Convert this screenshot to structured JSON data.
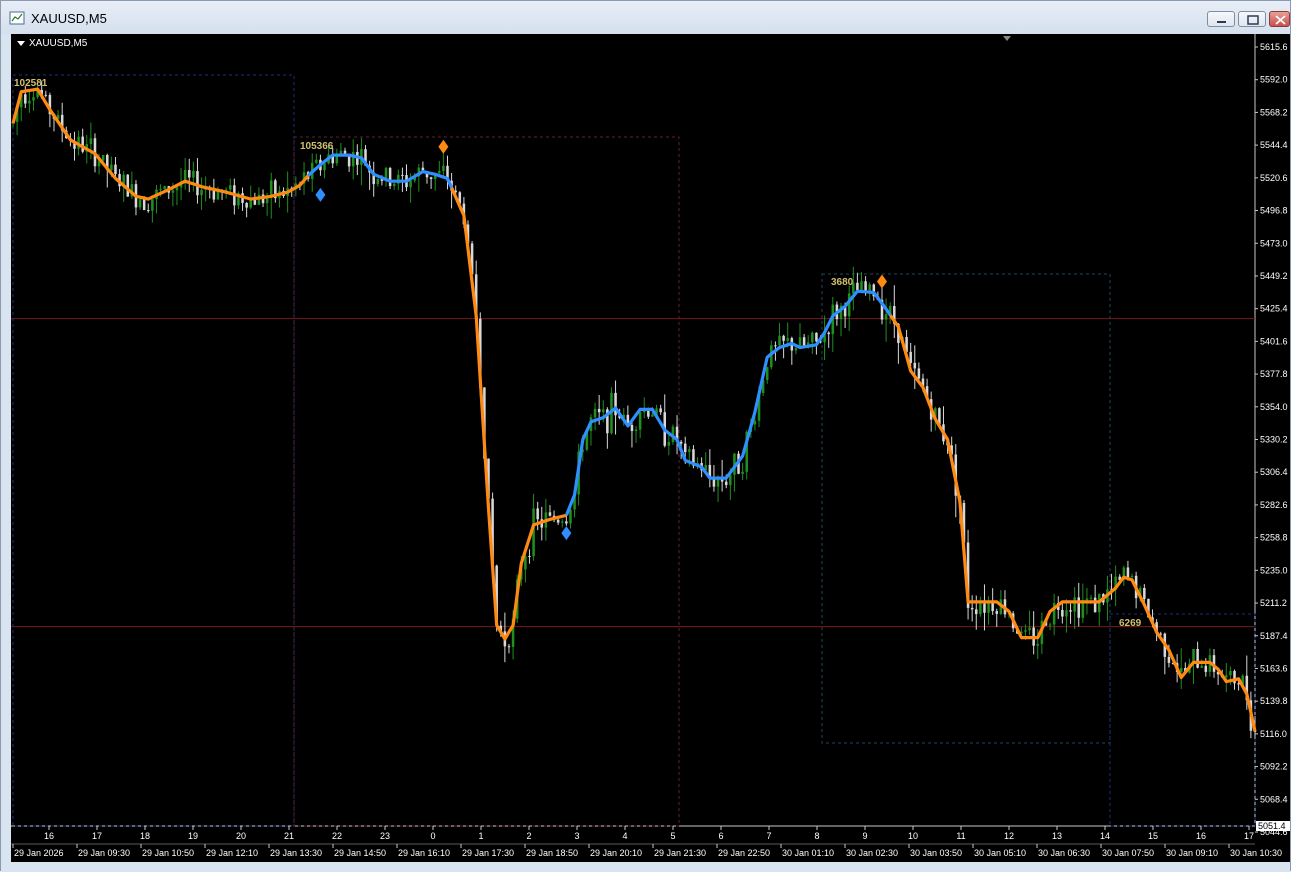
{
  "window": {
    "title": "XAUUSD,M5"
  },
  "chart": {
    "label": "XAUUSD,M5"
  },
  "colors": {
    "background": "#000000",
    "bull_candle": "#1f8f1f",
    "bear_candle": "#d8d8d8",
    "line_up": "#2f8fff",
    "line_down": "#ff8a12",
    "level_line": "#7a1a1a",
    "annotation_text": "#d0c070"
  },
  "price_axis": {
    "ticks": [
      "5615.6",
      "5592.0",
      "5568.2",
      "5544.4",
      "5520.6",
      "5496.8",
      "5473.0",
      "5449.2",
      "5425.4",
      "5401.6",
      "5377.8",
      "5354.0",
      "5330.2",
      "5306.4",
      "5282.6",
      "5258.8",
      "5235.0",
      "5211.2",
      "5187.4",
      "5163.6",
      "5139.8",
      "5116.0",
      "5092.2",
      "5068.4",
      "5044.6"
    ],
    "current_price": "5051.4"
  },
  "time_axis": {
    "hour_ticks": [
      "16",
      "17",
      "18",
      "19",
      "20",
      "21",
      "22",
      "23",
      "0",
      "1",
      "2",
      "3",
      "4",
      "5",
      "6",
      "7",
      "8",
      "9",
      "10",
      "11",
      "12",
      "13",
      "14",
      "15",
      "16",
      "17",
      "18"
    ],
    "date_labels": [
      "29 Jan 2026",
      "29 Jan 09:30",
      "29 Jan 10:50",
      "29 Jan 12:10",
      "29 Jan 13:30",
      "29 Jan 14:50",
      "29 Jan 16:10",
      "29 Jan 17:30",
      "29 Jan 18:50",
      "29 Jan 20:10",
      "29 Jan 21:30",
      "29 Jan 22:50",
      "30 Jan 01:10",
      "30 Jan 02:30",
      "30 Jan 03:50",
      "30 Jan 05:10",
      "30 Jan 06:30",
      "30 Jan 07:50",
      "30 Jan 09:10",
      "30 Jan 10:30"
    ]
  },
  "annotations": [
    {
      "text": "102581"
    },
    {
      "text": "105366"
    },
    {
      "text": "3680"
    },
    {
      "text": "6269"
    }
  ],
  "signals": [
    {
      "type": "buy",
      "color": "#2f8fff"
    },
    {
      "type": "sell",
      "color": "#ff8a12"
    },
    {
      "type": "buy",
      "color": "#2f8fff"
    },
    {
      "type": "sell",
      "color": "#ff8a12"
    }
  ],
  "chart_data": {
    "type": "candlestick",
    "symbol": "XAUUSD",
    "timeframe": "M5",
    "ylim": [
      5044.6,
      5615.6
    ],
    "horizontal_levels": [
      5418.0,
      5194.0
    ],
    "trend_line": [
      {
        "t": 0,
        "v": 5560
      },
      {
        "t": 2,
        "v": 5583
      },
      {
        "t": 6,
        "v": 5585
      },
      {
        "t": 9,
        "v": 5570
      },
      {
        "t": 14,
        "v": 5548
      },
      {
        "t": 20,
        "v": 5538
      },
      {
        "t": 25,
        "v": 5520
      },
      {
        "t": 30,
        "v": 5507
      },
      {
        "t": 33,
        "v": 5505
      },
      {
        "t": 38,
        "v": 5512
      },
      {
        "t": 42,
        "v": 5518
      },
      {
        "t": 46,
        "v": 5514
      },
      {
        "t": 52,
        "v": 5510
      },
      {
        "t": 58,
        "v": 5505
      },
      {
        "t": 63,
        "v": 5507
      },
      {
        "t": 67,
        "v": 5510
      },
      {
        "t": 70,
        "v": 5515
      },
      {
        "t": 72,
        "v": 5522
      },
      {
        "t": 75,
        "v": 5530
      },
      {
        "t": 78,
        "v": 5537
      },
      {
        "t": 82,
        "v": 5537
      },
      {
        "t": 85,
        "v": 5535
      },
      {
        "t": 88,
        "v": 5523
      },
      {
        "t": 92,
        "v": 5518
      },
      {
        "t": 96,
        "v": 5518
      },
      {
        "t": 100,
        "v": 5525
      },
      {
        "t": 103,
        "v": 5523
      },
      {
        "t": 106,
        "v": 5520
      },
      {
        "t": 110,
        "v": 5493
      },
      {
        "t": 113,
        "v": 5420
      },
      {
        "t": 116,
        "v": 5280
      },
      {
        "t": 118,
        "v": 5195
      },
      {
        "t": 120,
        "v": 5185
      },
      {
        "t": 122,
        "v": 5195
      },
      {
        "t": 124,
        "v": 5240
      },
      {
        "t": 127,
        "v": 5268
      },
      {
        "t": 131,
        "v": 5272
      },
      {
        "t": 135,
        "v": 5275
      },
      {
        "t": 137,
        "v": 5290
      },
      {
        "t": 139,
        "v": 5330
      },
      {
        "t": 141,
        "v": 5343
      },
      {
        "t": 144,
        "v": 5346
      },
      {
        "t": 147,
        "v": 5353
      },
      {
        "t": 150,
        "v": 5340
      },
      {
        "t": 153,
        "v": 5352
      },
      {
        "t": 156,
        "v": 5352
      },
      {
        "t": 159,
        "v": 5337
      },
      {
        "t": 162,
        "v": 5330
      },
      {
        "t": 164,
        "v": 5315
      },
      {
        "t": 168,
        "v": 5310
      },
      {
        "t": 170,
        "v": 5302
      },
      {
        "t": 174,
        "v": 5302
      },
      {
        "t": 178,
        "v": 5318
      },
      {
        "t": 181,
        "v": 5350
      },
      {
        "t": 184,
        "v": 5390
      },
      {
        "t": 187,
        "v": 5397
      },
      {
        "t": 190,
        "v": 5400
      },
      {
        "t": 192,
        "v": 5397
      },
      {
        "t": 196,
        "v": 5399
      },
      {
        "t": 198,
        "v": 5408
      },
      {
        "t": 200,
        "v": 5420
      },
      {
        "t": 203,
        "v": 5427
      },
      {
        "t": 206,
        "v": 5438
      },
      {
        "t": 210,
        "v": 5437
      },
      {
        "t": 213,
        "v": 5425
      },
      {
        "t": 216,
        "v": 5412
      },
      {
        "t": 219,
        "v": 5380
      },
      {
        "t": 222,
        "v": 5368
      },
      {
        "t": 225,
        "v": 5345
      },
      {
        "t": 228,
        "v": 5330
      },
      {
        "t": 231,
        "v": 5285
      },
      {
        "t": 233,
        "v": 5212
      },
      {
        "t": 236,
        "v": 5212
      },
      {
        "t": 240,
        "v": 5212
      },
      {
        "t": 243,
        "v": 5205
      },
      {
        "t": 246,
        "v": 5186
      },
      {
        "t": 250,
        "v": 5186
      },
      {
        "t": 253,
        "v": 5205
      },
      {
        "t": 256,
        "v": 5212
      },
      {
        "t": 260,
        "v": 5212
      },
      {
        "t": 265,
        "v": 5212
      },
      {
        "t": 269,
        "v": 5222
      },
      {
        "t": 271,
        "v": 5230
      },
      {
        "t": 273,
        "v": 5228
      },
      {
        "t": 276,
        "v": 5210
      },
      {
        "t": 279,
        "v": 5190
      },
      {
        "t": 282,
        "v": 5177
      },
      {
        "t": 285,
        "v": 5157
      },
      {
        "t": 288,
        "v": 5168
      },
      {
        "t": 292,
        "v": 5168
      },
      {
        "t": 294,
        "v": 5163
      },
      {
        "t": 296,
        "v": 5154
      },
      {
        "t": 299,
        "v": 5156
      },
      {
        "t": 301,
        "v": 5145
      },
      {
        "t": 303,
        "v": 5118
      }
    ],
    "trend_up_ranges": [
      [
        72,
        88
      ],
      [
        88,
        106
      ],
      [
        135,
        181
      ],
      [
        181,
        213
      ]
    ]
  }
}
